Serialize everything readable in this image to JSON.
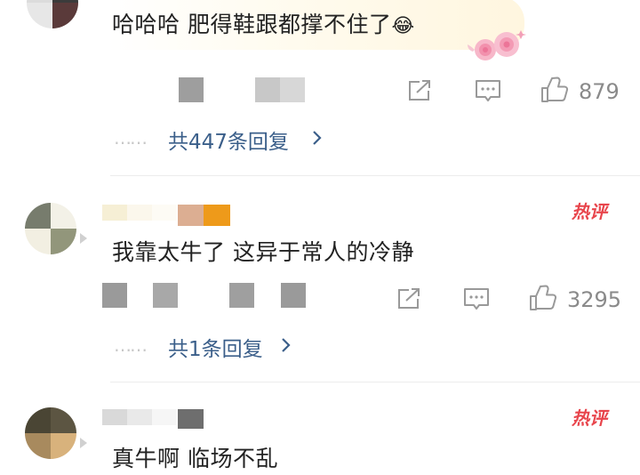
{
  "comments": [
    {
      "text": "哈哈哈 肥得鞋跟都撑不住了",
      "emoji": "😂",
      "likes": "879",
      "reply_link": "共447条回复"
    },
    {
      "text": "我靠太牛了 这异于常人的冷静",
      "badge": "热评",
      "likes": "3295",
      "reply_link": "共1条回复"
    },
    {
      "text": "真牛啊 临场不乱",
      "badge": "热评"
    }
  ],
  "icons": {
    "share": "share-icon",
    "comment": "comment-icon",
    "like": "thumbs-up-icon",
    "chevron": "chevron-right-icon",
    "dots": "……"
  },
  "colors": {
    "link": "#3b5f8a",
    "hot_badge": "#e8454c",
    "meta": "#8a8a8a"
  }
}
